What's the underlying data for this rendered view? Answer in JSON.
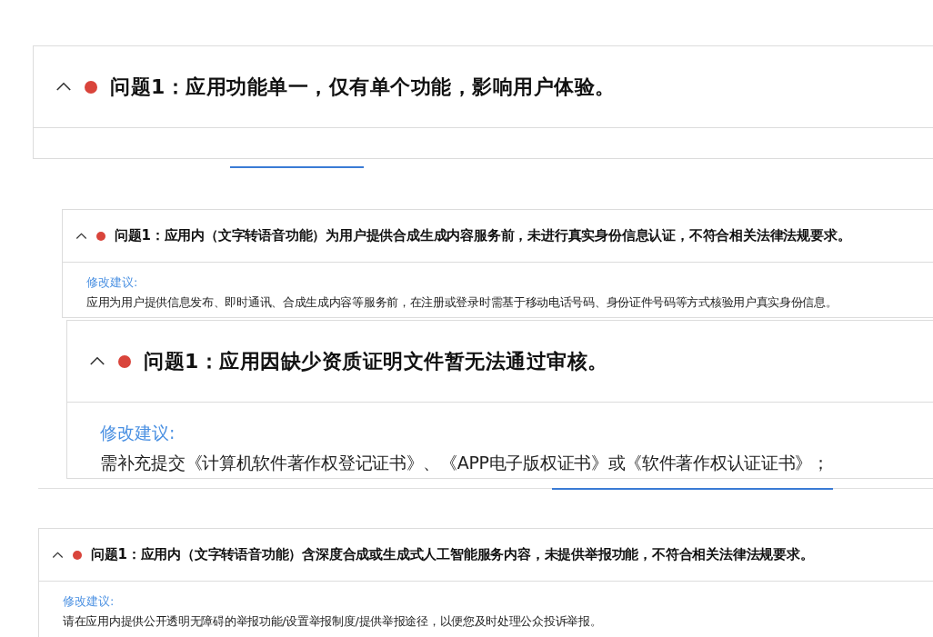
{
  "cards": [
    {
      "kind": "large",
      "expanded": true,
      "title": "问题1：应用功能单一，仅有单个功能，影响用户体验。"
    },
    {
      "kind": "small",
      "expanded": true,
      "title": "问题1：应用内（文字转语音功能）为用户提供合成生成内容服务前，未进行真实身份信息认证，不符合相关法律法规要求。",
      "suggestion_label": "修改建议:",
      "suggestion": "应用为用户提供信息发布、即时通讯、合成生成内容等服务前，在注册或登录时需基于移动电话号码、身份证件号码等方式核验用户真实身份信息。"
    },
    {
      "kind": "large",
      "expanded": true,
      "title": "问题1：应用因缺少资质证明文件暂无法通过审核。",
      "suggestion_label": "修改建议:",
      "suggestion": "需补充提交《计算机软件著作权登记证书》、《APP电子版权证书》或《软件著作权认证证书》；"
    },
    {
      "kind": "small",
      "expanded": true,
      "title": "问题1：应用内（文字转语音功能）含深度合成或生成式人工智能服务内容，未提供举报功能，不符合相关法律法规要求。",
      "suggestion_label": "修改建议:",
      "suggestion": "请在应用内提供公开透明无障碍的举报功能/设置举报制度/提供举报途径，以便您及时处理公众投诉举报。"
    }
  ]
}
